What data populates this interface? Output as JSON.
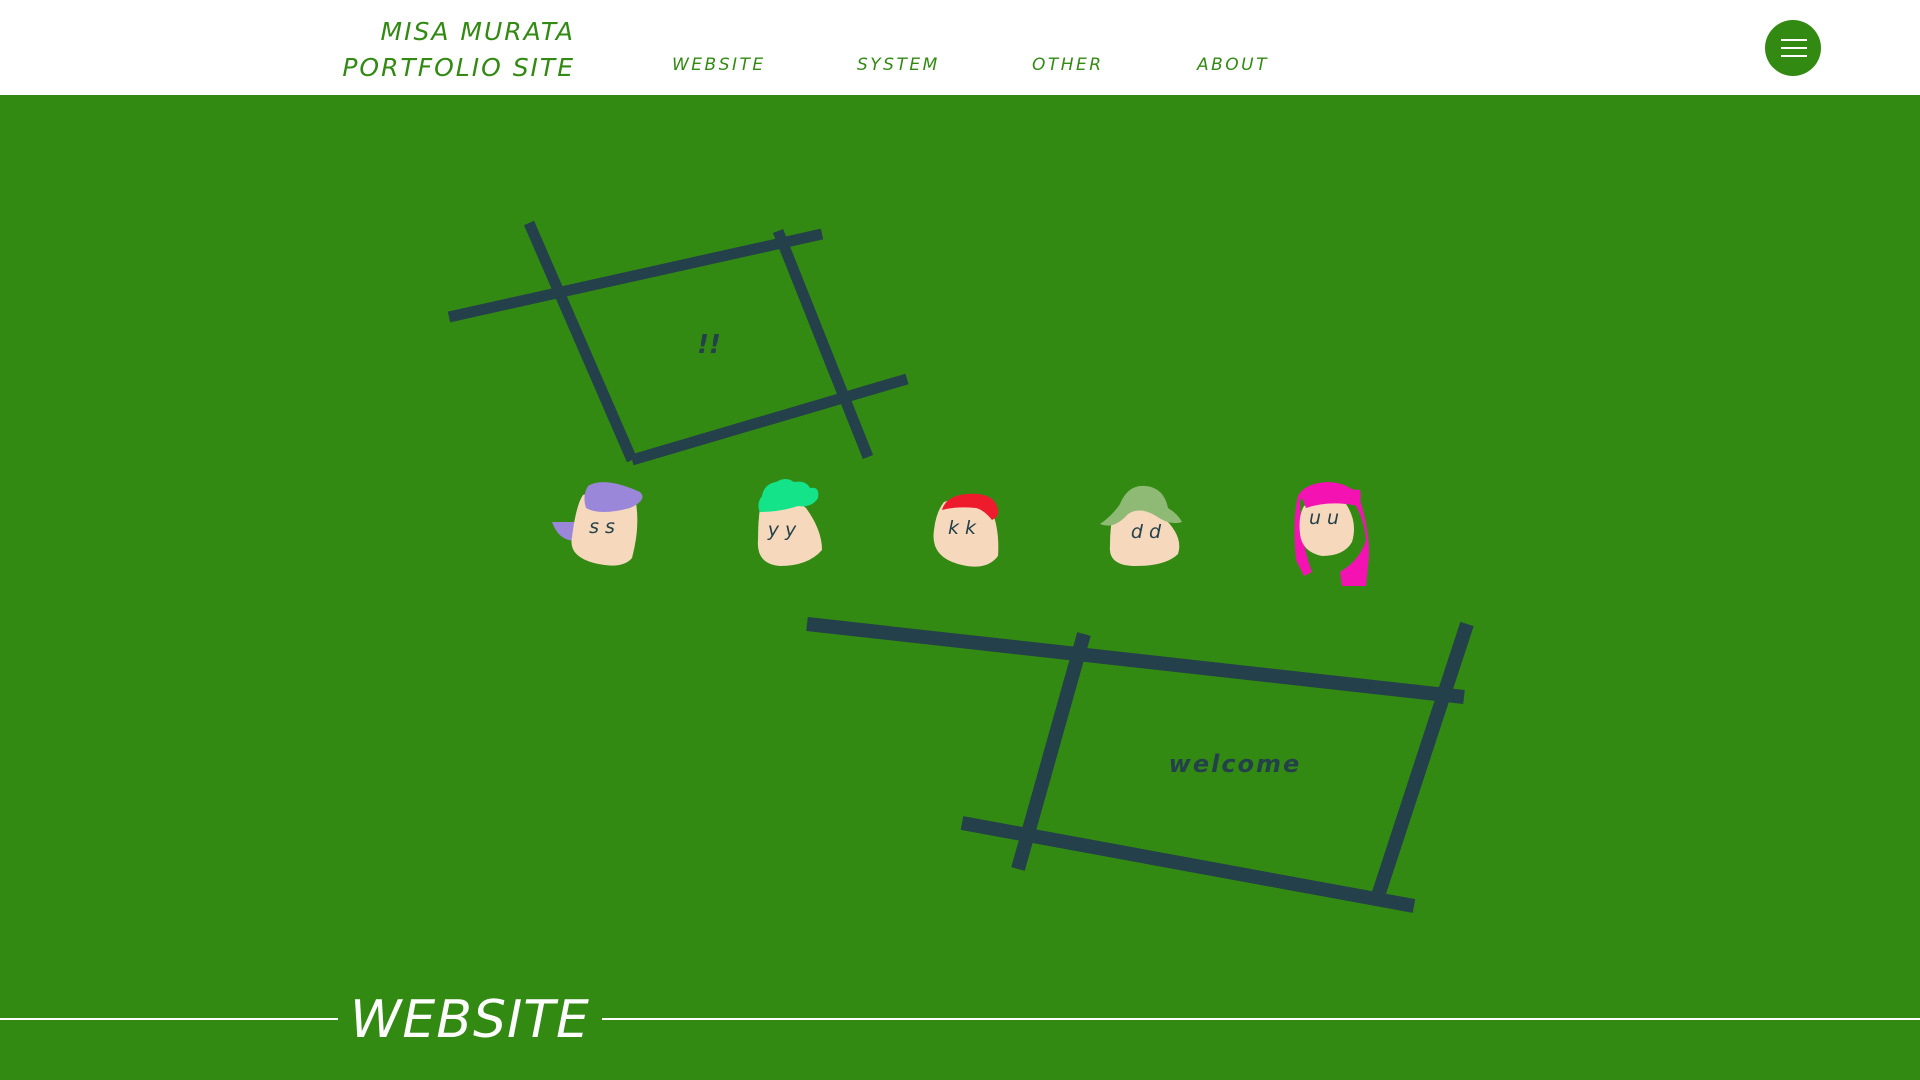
{
  "header": {
    "title_line1": "MISA MURATA",
    "title_line2": "PORTFOLIO SITE",
    "nav": [
      {
        "label": "WEBSITE"
      },
      {
        "label": "SYSTEM"
      },
      {
        "label": "OTHER"
      },
      {
        "label": "ABOUT"
      }
    ],
    "menu_icon": "hamburger-icon"
  },
  "hero": {
    "frame1_text": "!!",
    "frame2_text": "welcome",
    "characters": [
      {
        "label": "s s",
        "hair_color": "#9b87d9"
      },
      {
        "label": "y y",
        "hair_color": "#14e38a"
      },
      {
        "label": "k k",
        "hair_color": "#ee1b2d"
      },
      {
        "label": "d d",
        "hair_color": "#8fba76"
      },
      {
        "label": "u u",
        "hair_color": "#f412b3"
      }
    ]
  },
  "section": {
    "title": "WEBSITE"
  },
  "colors": {
    "brand_green": "#338a13",
    "frame_dark": "#24404a",
    "skin": "#f6d9bc",
    "white": "#ffffff"
  }
}
